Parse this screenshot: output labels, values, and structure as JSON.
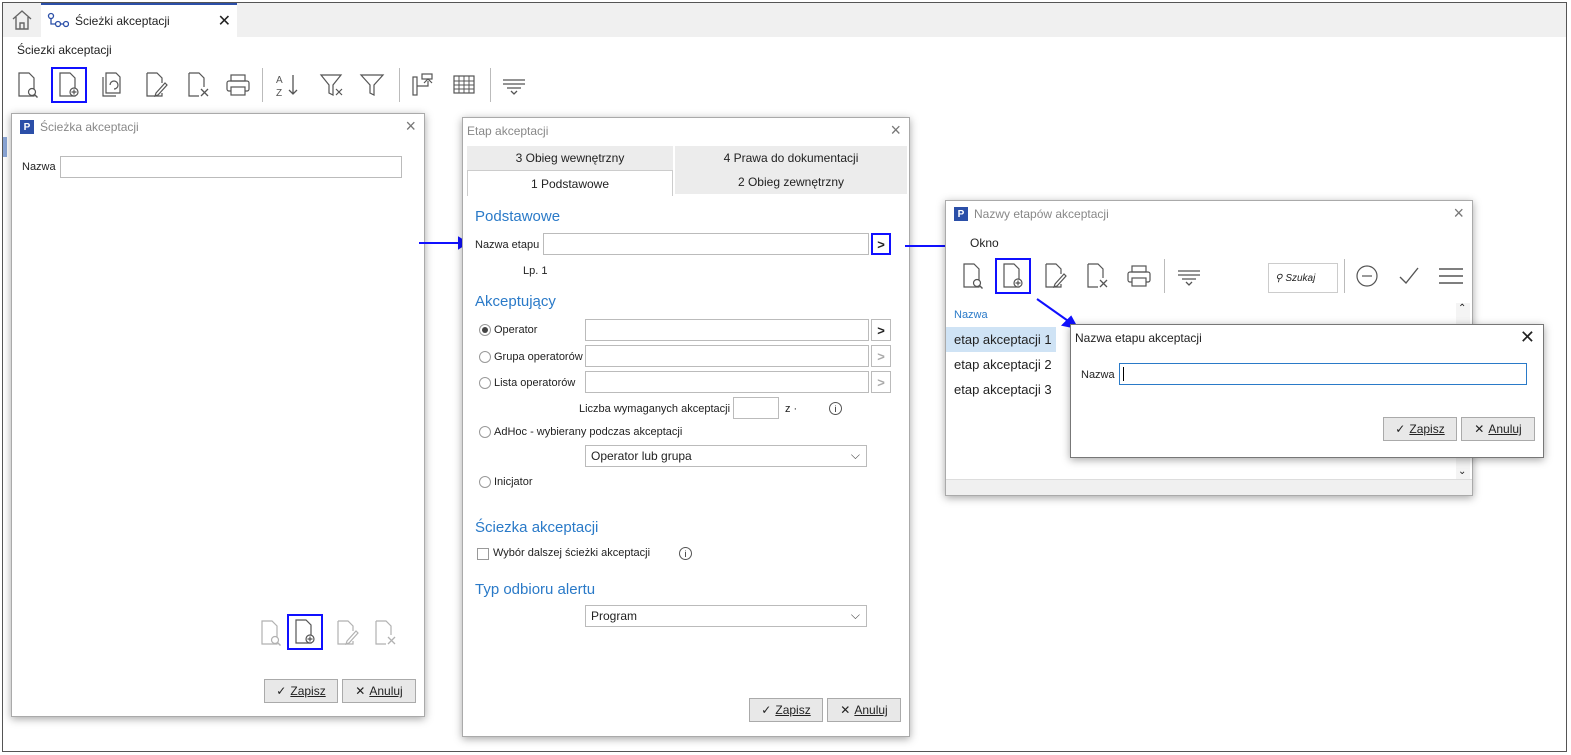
{
  "tab": {
    "title": "Ścieżki akceptacji"
  },
  "page": {
    "title": "Ściezki akceptacji"
  },
  "win1": {
    "title": "Ścieżka akceptacji",
    "name_label": "Nazwa",
    "save": "Zapisz",
    "cancel": "Anuluj"
  },
  "win2": {
    "title": "Etap akceptacji",
    "tabs": [
      "3 Obieg wewnętrzny",
      "4 Prawa do dokumentacji",
      "1 Podstawowe",
      "2 Obieg zewnętrzny"
    ],
    "sec_basic": "Podstawowe",
    "stage_name_label": "Nazwa etapu",
    "lp": "Lp. 1",
    "sec_acceptor": "Akceptujący",
    "radio_operator": "Operator",
    "radio_group": "Grupa operatorów",
    "radio_list": "Lista operatorów",
    "required_label": "Liczba wymaganych akceptacji",
    "z_label": "z ·",
    "radio_adhoc": "AdHoc - wybierany podczas akceptacji",
    "adhoc_select": "Operator lub grupa",
    "radio_initiator": "Inicjator",
    "sec_path": "Ściezka akceptacji",
    "checkbox_next": "Wybór dalszej ścieżki akceptacji",
    "sec_alert": "Typ odbioru alertu",
    "alert_select": "Program",
    "save": "Zapisz",
    "cancel": "Anuluj"
  },
  "win3": {
    "title": "Nazwy etapów akceptacji",
    "menu": "Okno",
    "search": "Szukaj",
    "col": "Nazwa",
    "rows": [
      "etap akceptacji 1",
      "etap akceptacji 2",
      "etap akceptacji 3"
    ]
  },
  "win4": {
    "title": "Nazwa etapu akceptacji",
    "name_label": "Nazwa",
    "save": "Zapisz",
    "cancel": "Anuluj"
  },
  "colors": {
    "highlight": "#1010ff",
    "accent": "#2a7ac8",
    "brand": "#2b4fa8"
  }
}
